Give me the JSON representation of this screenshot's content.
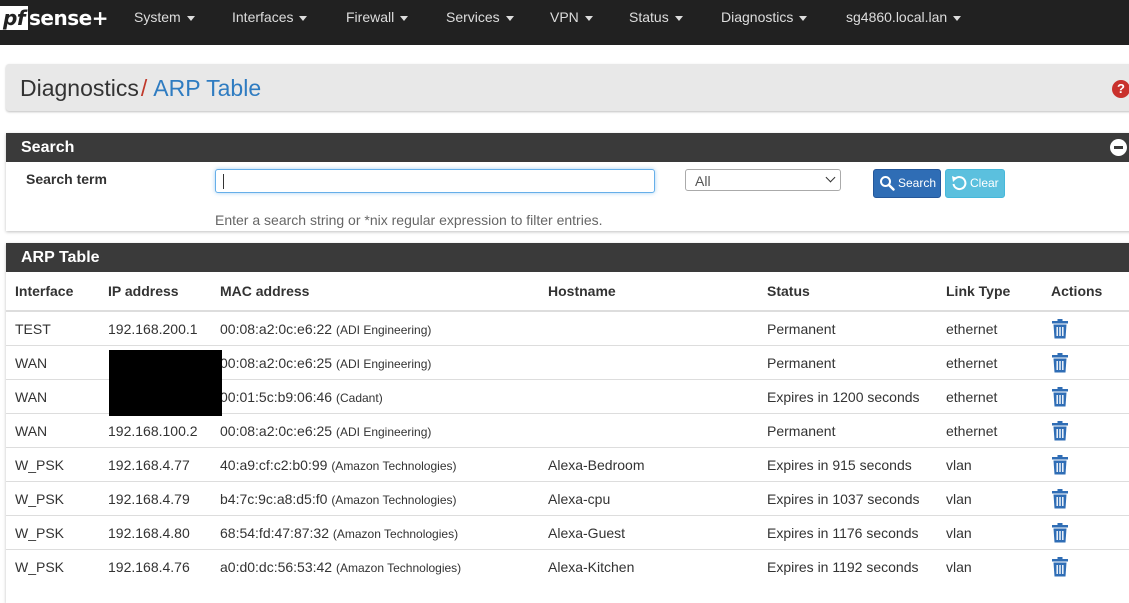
{
  "brand": {
    "pf": "pf",
    "sense": "sense",
    "plus": "+"
  },
  "nav": {
    "items": [
      "System",
      "Interfaces",
      "Firewall",
      "Services",
      "VPN",
      "Status",
      "Diagnostics",
      "sg4860.local.lan"
    ]
  },
  "breadcrumb": {
    "parent": "Diagnostics",
    "separator": "/",
    "current": "ARP Table"
  },
  "help_icon": "question-circle-icon",
  "search_panel": {
    "title": "Search",
    "label": "Search term",
    "input_value": "",
    "select_value": "All",
    "search_button": "Search",
    "clear_button": "Clear",
    "help_text": "Enter a search string or *nix regular expression to filter entries."
  },
  "arp_panel": {
    "title": "ARP Table",
    "columns": [
      "Interface",
      "IP address",
      "MAC address",
      "Hostname",
      "Status",
      "Link Type",
      "Actions"
    ],
    "rows": [
      {
        "interface": "TEST",
        "ip": "192.168.200.1",
        "mac": "00:08:a2:0c:e6:22",
        "vendor": "(ADI Engineering)",
        "hostname": "",
        "status": "Permanent",
        "link": "ethernet"
      },
      {
        "interface": "WAN",
        "ip": "",
        "mac": "00:08:a2:0c:e6:25",
        "vendor": "(ADI Engineering)",
        "hostname": "",
        "status": "Permanent",
        "link": "ethernet"
      },
      {
        "interface": "WAN",
        "ip": "",
        "mac": "00:01:5c:b9:06:46",
        "vendor": "(Cadant)",
        "hostname": "",
        "status": "Expires in 1200 seconds",
        "link": "ethernet"
      },
      {
        "interface": "WAN",
        "ip": "192.168.100.2",
        "mac": "00:08:a2:0c:e6:25",
        "vendor": "(ADI Engineering)",
        "hostname": "",
        "status": "Permanent",
        "link": "ethernet"
      },
      {
        "interface": "W_PSK",
        "ip": "192.168.4.77",
        "mac": "40:a9:cf:c2:b0:99",
        "vendor": "(Amazon Technologies)",
        "hostname": "Alexa-Bedroom",
        "status": "Expires in 915 seconds",
        "link": "vlan"
      },
      {
        "interface": "W_PSK",
        "ip": "192.168.4.79",
        "mac": "b4:7c:9c:a8:d5:f0",
        "vendor": "(Amazon Technologies)",
        "hostname": "Alexa-cpu",
        "status": "Expires in 1037 seconds",
        "link": "vlan"
      },
      {
        "interface": "W_PSK",
        "ip": "192.168.4.80",
        "mac": "68:54:fd:47:87:32",
        "vendor": "(Amazon Technologies)",
        "hostname": "Alexa-Guest",
        "status": "Expires in 1176 seconds",
        "link": "vlan"
      },
      {
        "interface": "W_PSK",
        "ip": "192.168.4.76",
        "mac": "a0:d0:dc:56:53:42",
        "vendor": "(Amazon Technologies)",
        "hostname": "Alexa-Kitchen",
        "status": "Expires in 1192 seconds",
        "link": "vlan"
      }
    ],
    "action_icon": "trash-icon"
  },
  "colors": {
    "navbar": "#212121",
    "panel_heading": "#3a3a3a",
    "breadcrumb_link": "#2f7cc1",
    "search_button": "#2f6db5",
    "clear_button": "#5bc0de",
    "trash": "#2f6db5"
  }
}
